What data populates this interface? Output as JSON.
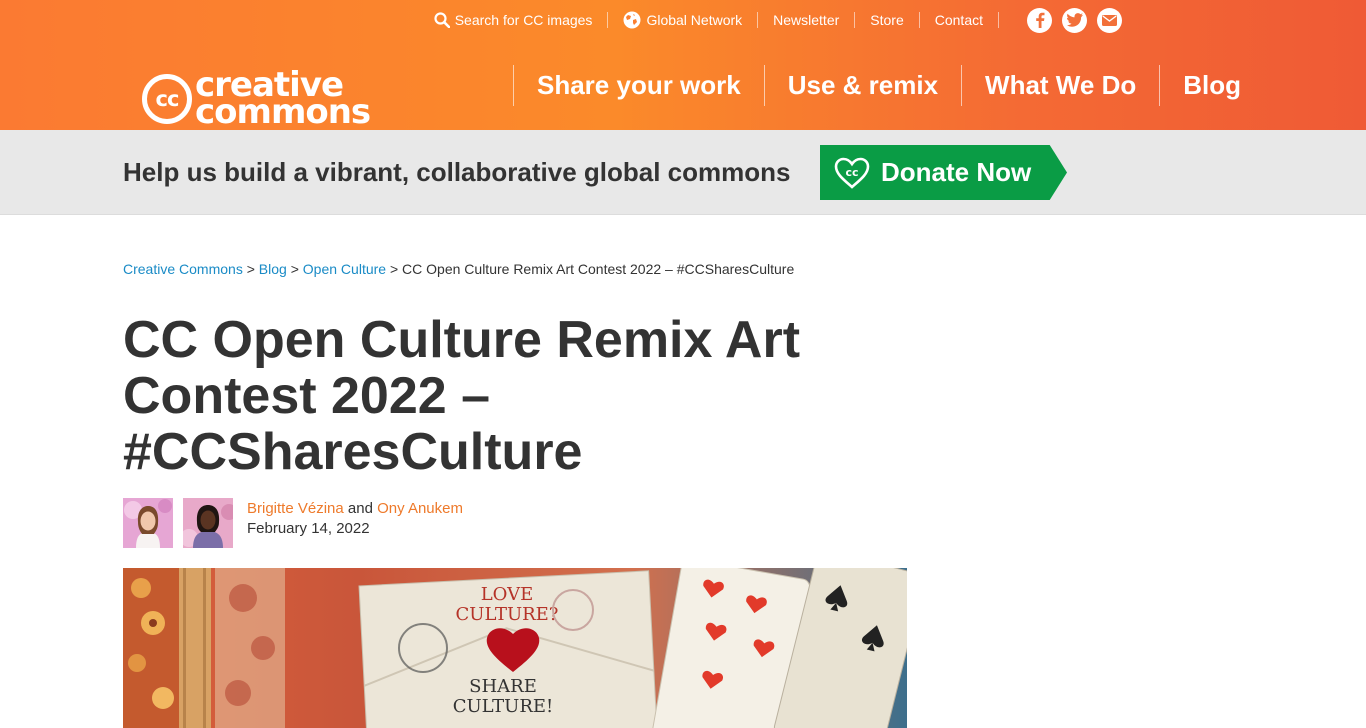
{
  "utility_nav": {
    "search_label": "Search for CC images",
    "global_label": "Global Network",
    "newsletter_label": "Newsletter",
    "store_label": "Store",
    "contact_label": "Contact"
  },
  "logo": {
    "cc_mark": "cc",
    "word_top": "creative",
    "word_bottom": "commons"
  },
  "main_nav": [
    "Share your work",
    "Use & remix",
    "What We Do",
    "Blog"
  ],
  "banner": {
    "text": "Help us build a vibrant, collaborative global commons",
    "donate_label": "Donate Now"
  },
  "breadcrumb": {
    "items": [
      "Creative Commons",
      "Blog",
      "Open Culture"
    ],
    "separator": ">",
    "current": "CC Open Culture Remix Art Contest 2022 – #CCSharesCulture"
  },
  "post": {
    "title": "CC Open Culture Remix Art Contest 2022 – #CCSharesCulture",
    "author_1": "Brigitte Vézina",
    "conjunction": "and",
    "author_2": "Ony Anukem",
    "date": "February 14, 2022"
  },
  "hero": {
    "line_1": "LOVE",
    "line_2": "CULTURE?",
    "line_3": "SHARE",
    "line_4": "CULTURE!"
  },
  "colors": {
    "header_orange": "#fb7a32",
    "donate_green": "#0a9c45",
    "link_blue": "#1a8bc6",
    "author_orange": "#ee7a2b"
  }
}
